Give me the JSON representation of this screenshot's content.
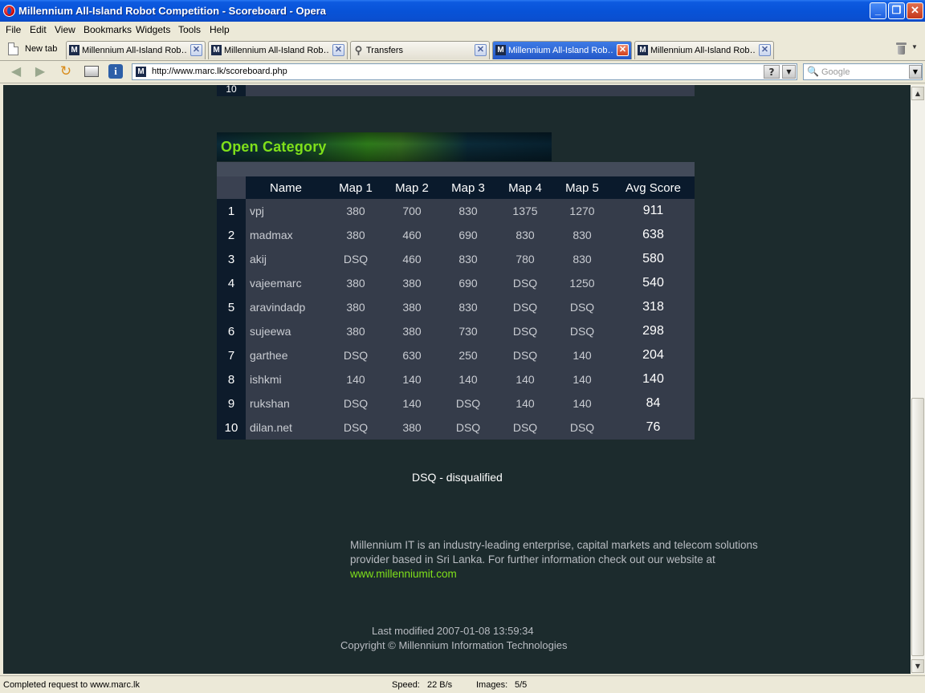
{
  "window": {
    "title": "Millennium All-Island Robot Competition - Scoreboard - Opera",
    "minimize": "_",
    "maximize": "❐",
    "close": "✕"
  },
  "menu": [
    "File",
    "Edit",
    "View",
    "Bookmarks",
    "Widgets",
    "Tools",
    "Help"
  ],
  "tabs": {
    "new_tab_label": "New tab",
    "items": [
      {
        "label": "Millennium All-Island Rob…",
        "favicon": "M",
        "active": false
      },
      {
        "label": "Millennium All-Island Rob…",
        "favicon": "M",
        "active": false
      },
      {
        "label": "Transfers",
        "favicon": "transfers-icon",
        "active": false
      },
      {
        "label": "Millennium All-Island Rob…",
        "favicon": "M",
        "active": true
      },
      {
        "label": "Millennium All-Island Rob…",
        "favicon": "M",
        "active": false
      }
    ],
    "close_glyph": "✕"
  },
  "address": {
    "favicon": "M",
    "url": "http://www.marc.lk/scoreboard.php",
    "help": "?",
    "search_placeholder": "Google"
  },
  "page": {
    "prev_table_last_rank": "10",
    "category_title": "Open Category",
    "table": {
      "headers": [
        "Name",
        "Map 1",
        "Map 2",
        "Map 3",
        "Map 4",
        "Map 5",
        "Avg Score"
      ],
      "rows": [
        {
          "rank": "1",
          "name": "vpj",
          "maps": [
            "380",
            "700",
            "830",
            "1375",
            "1270"
          ],
          "avg": "911"
        },
        {
          "rank": "2",
          "name": "madmax",
          "maps": [
            "380",
            "460",
            "690",
            "830",
            "830"
          ],
          "avg": "638"
        },
        {
          "rank": "3",
          "name": "akij",
          "maps": [
            "DSQ",
            "460",
            "830",
            "780",
            "830"
          ],
          "avg": "580"
        },
        {
          "rank": "4",
          "name": "vajeemarc",
          "maps": [
            "380",
            "380",
            "690",
            "DSQ",
            "1250"
          ],
          "avg": "540"
        },
        {
          "rank": "5",
          "name": "aravindadp",
          "maps": [
            "380",
            "380",
            "830",
            "DSQ",
            "DSQ"
          ],
          "avg": "318"
        },
        {
          "rank": "6",
          "name": "sujeewa",
          "maps": [
            "380",
            "380",
            "730",
            "DSQ",
            "DSQ"
          ],
          "avg": "298"
        },
        {
          "rank": "7",
          "name": "garthee",
          "maps": [
            "DSQ",
            "630",
            "250",
            "DSQ",
            "140"
          ],
          "avg": "204"
        },
        {
          "rank": "8",
          "name": "ishkmi",
          "maps": [
            "140",
            "140",
            "140",
            "140",
            "140"
          ],
          "avg": "140"
        },
        {
          "rank": "9",
          "name": "rukshan",
          "maps": [
            "DSQ",
            "140",
            "DSQ",
            "140",
            "140"
          ],
          "avg": "84"
        },
        {
          "rank": "10",
          "name": "dilan.net",
          "maps": [
            "DSQ",
            "380",
            "DSQ",
            "DSQ",
            "DSQ"
          ],
          "avg": "76"
        }
      ]
    },
    "dsq_note": "DSQ - disqualified",
    "about_line1": "Millennium IT is an industry-leading enterprise, capital markets and telecom solutions",
    "about_line2": "provider based in Sri Lanka. For further information check out our website at",
    "about_link": "www.millenniumit.com",
    "last_modified": "Last modified 2007-01-08 13:59:34",
    "copyright": "Copyright © Millennium Information Technologies"
  },
  "status": {
    "message": "Completed request to www.marc.lk",
    "speed_label": "Speed:",
    "speed_value": "22 B/s",
    "images_label": "Images:",
    "images_value": "5/5"
  },
  "colors": {
    "accent_green": "#7fe01a",
    "page_bg": "#1c2b2d",
    "table_row_bg": "#353c4a",
    "rank_cell_bg": "#0d1b2b"
  }
}
